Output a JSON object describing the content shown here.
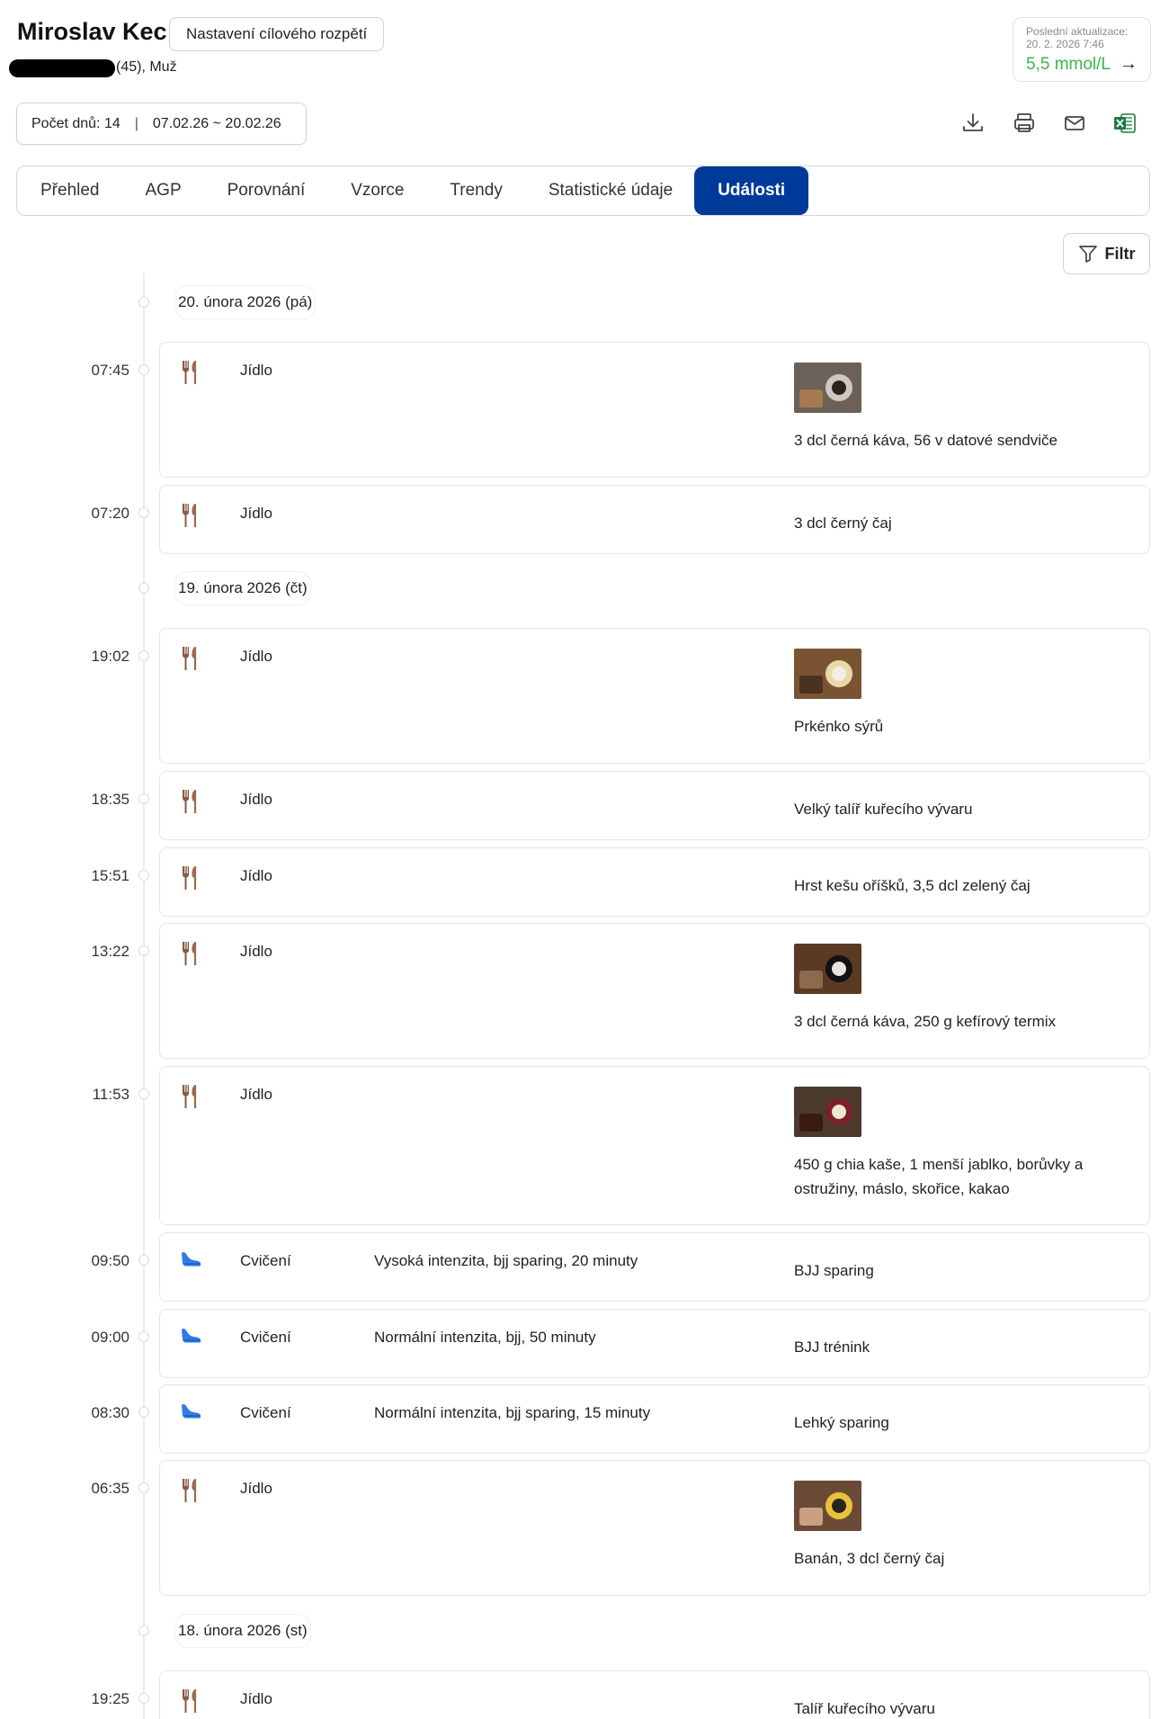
{
  "header": {
    "patient_name": "Miroslav Kec",
    "target_range_button": "Nastavení cílového rozpětí",
    "patient_meta": "(45), Muž",
    "last_update_label": "Poslední aktualizace:",
    "last_update_time": "20. 2. 2026 7:46",
    "last_value": "5,5 mmol/L",
    "arrow": "→"
  },
  "range": {
    "days_label": "Počet dnů: 14",
    "separator": "|",
    "dates": "07.02.26 ~ 20.02.26"
  },
  "toolbar": {
    "icons": [
      "download-icon",
      "print-icon",
      "email-icon",
      "excel-icon"
    ]
  },
  "tabs": [
    {
      "label": "Přehled"
    },
    {
      "label": "AGP"
    },
    {
      "label": "Porovnání"
    },
    {
      "label": "Vzorce"
    },
    {
      "label": "Trendy"
    },
    {
      "label": "Statistické údaje"
    },
    {
      "label": "Události",
      "active": true
    }
  ],
  "filter_label": "Filtr",
  "dates": [
    {
      "label": "20. února 2026 (pá)"
    },
    {
      "label": "19. února 2026 (čt)"
    },
    {
      "label": "18. února 2026 (st)"
    }
  ],
  "events": [
    {
      "time": "07:45",
      "type": "Jídlo",
      "kind": "meal",
      "detail": "",
      "note": "3 dcl černá káva, 56 v datové sendviče",
      "photo": "photo-coffee-sandwich"
    },
    {
      "time": "07:20",
      "type": "Jídlo",
      "kind": "meal",
      "detail": "",
      "note": "3 dcl černý čaj",
      "photo": ""
    },
    {
      "time": "19:02",
      "type": "Jídlo",
      "kind": "meal",
      "detail": "",
      "note": "Prkénko sýrů",
      "photo": "photo-cheese-board"
    },
    {
      "time": "18:35",
      "type": "Jídlo",
      "kind": "meal",
      "detail": "",
      "note": "Velký talíř kuřecího vývaru",
      "photo": ""
    },
    {
      "time": "15:51",
      "type": "Jídlo",
      "kind": "meal",
      "detail": "",
      "note": "Hrst kešu oříšků, 3,5 dcl zelený čaj",
      "photo": ""
    },
    {
      "time": "13:22",
      "type": "Jídlo",
      "kind": "meal",
      "detail": "",
      "note": "3 dcl černá káva, 250 g kefírový termix",
      "photo": "photo-coffee-cup"
    },
    {
      "time": "11:53",
      "type": "Jídlo",
      "kind": "meal",
      "detail": "",
      "note": "450 g chia kaše, 1 menší jablko, borůvky a ostružiny, máslo, skořice, kakao",
      "photo": "photo-chia-bowl"
    },
    {
      "time": "09:50",
      "type": "Cvičení",
      "kind": "exercise",
      "detail": "Vysoká intenzita,  bjj sparing,  20 minuty",
      "note": "BJJ sparing",
      "photo": ""
    },
    {
      "time": "09:00",
      "type": "Cvičení",
      "kind": "exercise",
      "detail": "Normální intenzita,  bjj,  50 minuty",
      "note": "BJJ trénink",
      "photo": ""
    },
    {
      "time": "08:30",
      "type": "Cvičení",
      "kind": "exercise",
      "detail": "Normální intenzita,  bjj sparing,  15 minuty",
      "note": "Lehký sparing",
      "photo": ""
    },
    {
      "time": "06:35",
      "type": "Jídlo",
      "kind": "meal",
      "detail": "",
      "note": "Banán, 3 dcl černý čaj",
      "photo": "photo-banana"
    },
    {
      "time": "19:25",
      "type": "Jídlo",
      "kind": "meal",
      "detail": "",
      "note": "Talíř kuřecího vývaru",
      "photo": ""
    }
  ],
  "colors": {
    "accent": "#003a99",
    "glucose_ok": "#3bb54a",
    "meal_icon": "#8a5a44",
    "exercise_icon": "#2f7be8"
  }
}
